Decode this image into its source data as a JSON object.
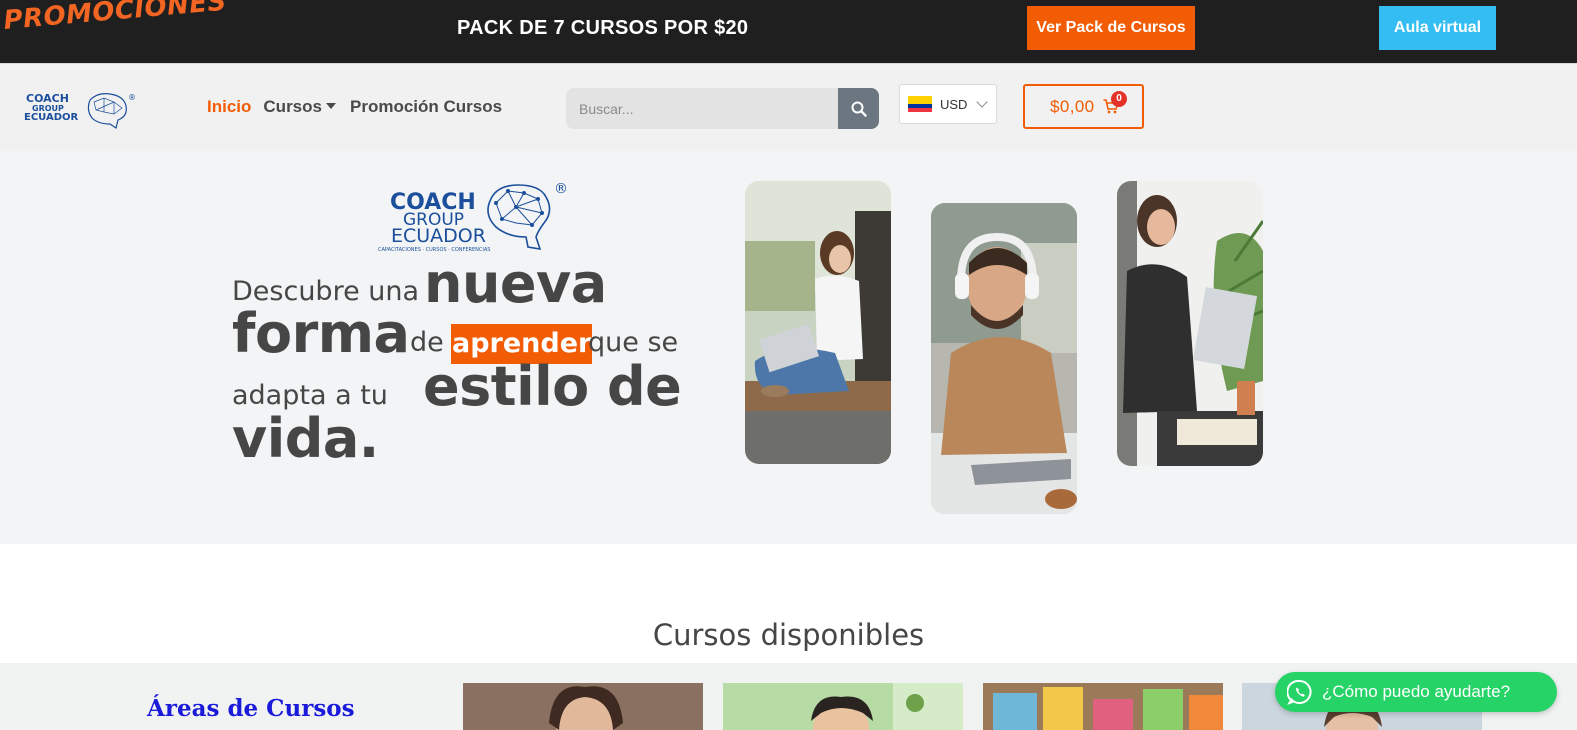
{
  "promo_bar": {
    "title": "PROMOCIONES",
    "pack_text": "PACK DE 7 CURSOS POR $20",
    "pack_button": "Ver Pack de Cursos",
    "aula_button": "Aula virtual"
  },
  "header": {
    "nav": [
      {
        "label": "Inicio"
      },
      {
        "label": "Cursos"
      },
      {
        "label": "Promoción Cursos"
      }
    ],
    "search": {
      "placeholder": "Buscar..."
    },
    "currency": {
      "code": "USD"
    },
    "cart": {
      "total": "$0,00",
      "count": "0"
    }
  },
  "logo": {
    "line1": "COACH",
    "line2": "GROUP",
    "line3": "ECUADOR",
    "tagline": "CAPACITACIONES · CURSOS · CONFERENCIAS",
    "mark": "®"
  },
  "hero": {
    "l1_small": "Descubre una",
    "l1_large": "nueva",
    "l2_large": "forma",
    "l2_small": "de",
    "l2_highlight": "aprender",
    "l2_small2": "que se",
    "l3_small": "adapta a tu",
    "l3_large": "estilo de",
    "l4_large": "vida."
  },
  "courses": {
    "title": "Cursos disponibles",
    "areas_title": "Áreas de Cursos"
  },
  "whatsapp": {
    "label": "¿Cómo puedo ayudarte?"
  },
  "colors": {
    "accent": "#f25c05",
    "aula": "#33bdf2",
    "whatsapp": "#25d366",
    "logo_blue": "#1b4f9c"
  }
}
